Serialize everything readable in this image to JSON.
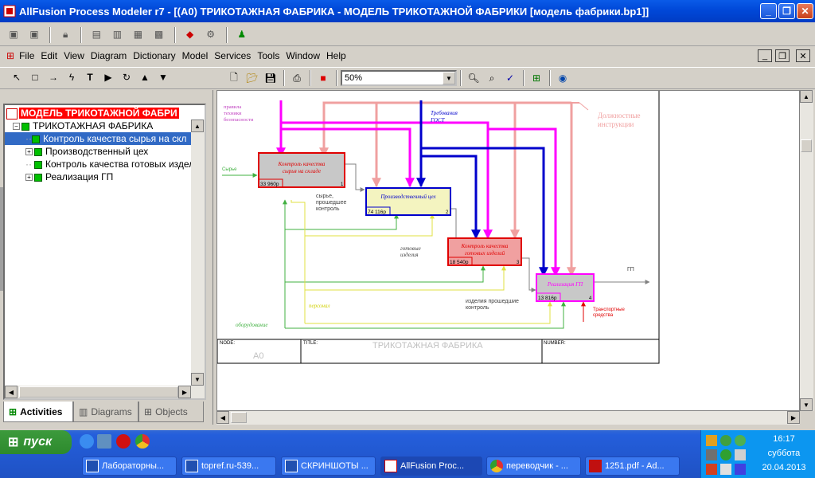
{
  "window": {
    "title": "AllFusion Process Modeler r7 - [(A0) ТРИКОТАЖНАЯ ФАБРИКА - МОДЕЛЬ ТРИКОТАЖНОЙ ФАБРИКИ  [модель фабрики.bp1]]"
  },
  "menu": [
    "File",
    "Edit",
    "View",
    "Diagram",
    "Dictionary",
    "Model",
    "Services",
    "Tools",
    "Window",
    "Help"
  ],
  "zoom": "50%",
  "tree": {
    "root": "МОДЕЛЬ ТРИКОТАЖНОЙ ФАБРИ",
    "items": [
      "ТРИКОТАЖНАЯ ФАБРИКА",
      "Контроль качества  сырья на скл",
      "Производственный цех",
      "Контроль качества  готовых издел",
      "Реализация ГП"
    ]
  },
  "tabs": [
    "Activities",
    "Diagrams",
    "Objects"
  ],
  "diagram": {
    "boxes": [
      {
        "title": "Контроль качества сырья на складе",
        "cost": "33 960р",
        "num": "1"
      },
      {
        "title": "Производственный цех",
        "cost": "74 116р",
        "num": "2"
      },
      {
        "title": "Контроль качества готовых изделий",
        "cost": "18 540р",
        "num": "3"
      },
      {
        "title": "Реализация ГП",
        "cost": "13 816р",
        "num": "4"
      }
    ],
    "labels": {
      "safety": "правила техники безопасности",
      "gost": "Требования ГОСТ",
      "duties": "Должностные инструкции",
      "raw": "Сырье",
      "checked_raw": "сырье, прошедшее контроль",
      "finished": "готовые изделия",
      "checked_goods": "изделия прошедшие контроль",
      "gp": "ГП",
      "staff": "персонал",
      "equipment": "оборудование",
      "transport": "Транспортные средства"
    },
    "frame": {
      "node_label": "NODE:",
      "node_value": "A0",
      "title_label": "TITLE:",
      "title_value": "ТРИКОТАЖНАЯ ФАБРИКА",
      "number_label": "NUMBER:"
    }
  },
  "taskbar": {
    "start": "пуск",
    "tasks": [
      "Лабораторны...",
      "topref.ru-539...",
      "СКРИНШОТЫ ...",
      "AllFusion Proc...",
      "переводчик - ...",
      "1251.pdf - Ad..."
    ],
    "time": "16:17",
    "day": "суббота",
    "date": "20.04.2013"
  },
  "colors": {
    "titlebar": "#0048d8",
    "magenta": "#ff00ff",
    "blue": "#0000cc",
    "pink": "#f0a0a0",
    "green": "#40b040",
    "yellow": "#f0f040",
    "red": "#e00000"
  }
}
